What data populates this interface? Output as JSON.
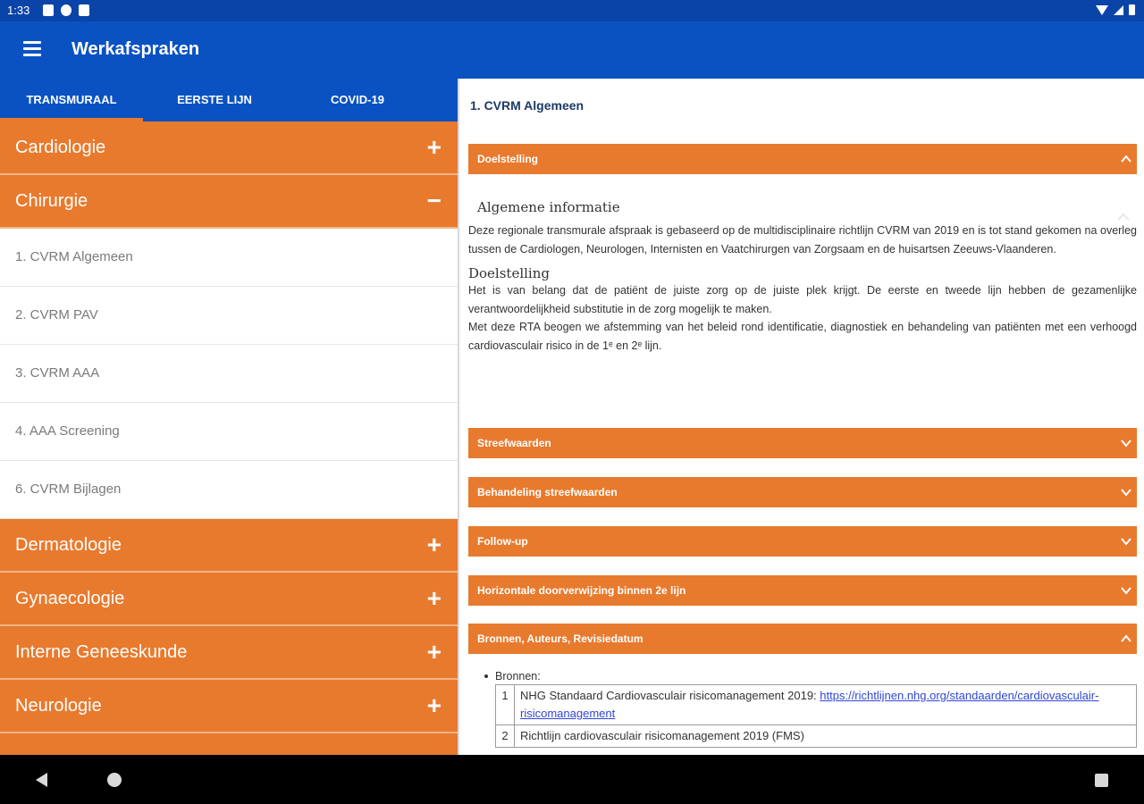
{
  "status_bar": {
    "time": "1:33"
  },
  "app": {
    "title": "Werkafspraken"
  },
  "tabs": [
    {
      "label": "TRANSMURAAL"
    },
    {
      "label": "EERSTE LIJN"
    },
    {
      "label": "COVID-19"
    }
  ],
  "list": {
    "cardiologie": {
      "label": "Cardiologie",
      "toggle": "+"
    },
    "chirurgie": {
      "label": "Chirurgie",
      "toggle": "−"
    },
    "sub": [
      {
        "label": "1. CVRM Algemeen"
      },
      {
        "label": "2. CVRM PAV"
      },
      {
        "label": "3. CVRM AAA"
      },
      {
        "label": "4. AAA Screening"
      },
      {
        "label": "6. CVRM Bijlagen"
      }
    ],
    "dermatologie": {
      "label": "Dermatologie",
      "toggle": "+"
    },
    "gynaecologie": {
      "label": "Gynaecologie",
      "toggle": "+"
    },
    "interne": {
      "label": "Interne Geneeskunde",
      "toggle": "+"
    },
    "neurologie": {
      "label": "Neurologie",
      "toggle": "+"
    }
  },
  "detail": {
    "title": "1. CVRM Algemeen",
    "sections": {
      "doelstelling": "Doelstelling",
      "streefwaarden": "Streefwaarden",
      "behandeling": "Behandeling streefwaarden",
      "followup": "Follow-up",
      "horizontaal": "Horizontale doorverwijzing binnen 2e lijn",
      "bronnen": "Bronnen, Auteurs, Revisiedatum"
    },
    "info_heading": "Algemene informatie",
    "info_text": "Deze regionale transmurale afspraak is gebaseerd op de multidisciplinaire richtlijn CVRM van 2019 en is tot stand gekomen na overleg tussen de Cardiologen, Neurologen, Internisten en Vaatchirurgen van Zorgsaam en de huisartsen Zeeuws-Vlaanderen.",
    "goal_heading": "Doelstelling",
    "goal_line1": "Het is van belang dat de patiënt de juiste zorg op de juiste plek krijgt. De eerste en tweede lijn hebben de gezamenlijke verantwoordelijkheid substitutie in de zorg mogelijk te maken.",
    "goal_line2": "Met deze RTA beogen we afstemming van het beleid rond identificatie, diagnostiek en behandeling van patiënten met een verhoogd cardiovasculair risico in de 1ᵉ en 2ᵉ lijn.",
    "sources_label": "Bronnen:",
    "sources": [
      {
        "num": "1",
        "text": "NHG Standaard Cardiovasculair risicomanagement 2019: ",
        "link": "https://richtlijnen.nhg.org/standaarden/cardiovasculair-risicomanagement"
      },
      {
        "num": "2",
        "text": "Richtlijn cardiovasculair risicomanagement 2019 (FMS)"
      }
    ]
  },
  "colors": {
    "primary": "#0a52c2",
    "status": "#0a44a8",
    "accent": "#e87a2e",
    "title_text": "#1c3a66"
  }
}
